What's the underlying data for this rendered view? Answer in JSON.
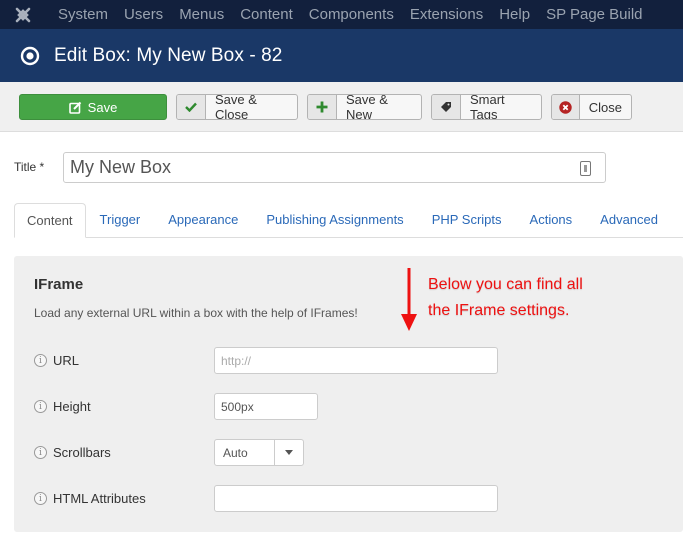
{
  "topnav": {
    "logo": "joomla-logo-icon",
    "items": [
      "System",
      "Users",
      "Menus",
      "Content",
      "Components",
      "Extensions",
      "Help",
      "SP Page Build"
    ]
  },
  "header": {
    "icon": "target-icon",
    "title": "Edit Box: My New Box - 82"
  },
  "toolbar": {
    "save": {
      "label": "Save",
      "icon": "edit-icon"
    },
    "save_close": {
      "label": "Save & Close",
      "icon": "check-icon"
    },
    "save_new": {
      "label": "Save & New",
      "icon": "plus-icon"
    },
    "smart_tags": {
      "label": "Smart Tags",
      "icon": "tag-icon"
    },
    "close": {
      "label": "Close",
      "icon": "close-circle-icon"
    }
  },
  "title_field": {
    "label": "Title *",
    "value": "My New Box"
  },
  "tabs": [
    {
      "label": "Content",
      "active": true
    },
    {
      "label": "Trigger",
      "active": false
    },
    {
      "label": "Appearance",
      "active": false
    },
    {
      "label": "Publishing Assignments",
      "active": false
    },
    {
      "label": "PHP Scripts",
      "active": false
    },
    {
      "label": "Actions",
      "active": false
    },
    {
      "label": "Advanced",
      "active": false
    }
  ],
  "panel": {
    "title": "IFrame",
    "description": "Load any external URL within a box with the help of IFrames!",
    "annotation_line1": "Below you can find all",
    "annotation_line2": "the IFrame settings.",
    "fields": {
      "url": {
        "label": "URL",
        "value": "",
        "placeholder": "http://"
      },
      "height": {
        "label": "Height",
        "value": "500px"
      },
      "scrollbars": {
        "label": "Scrollbars",
        "value": "Auto"
      },
      "html_attributes": {
        "label": "HTML Attributes",
        "value": ""
      }
    }
  },
  "colors": {
    "topnav_bg": "#12203d",
    "header_bg": "#1a3867",
    "save_green": "#46a546",
    "tab_link": "#2a69b8",
    "annotation_red": "#ee1111"
  }
}
